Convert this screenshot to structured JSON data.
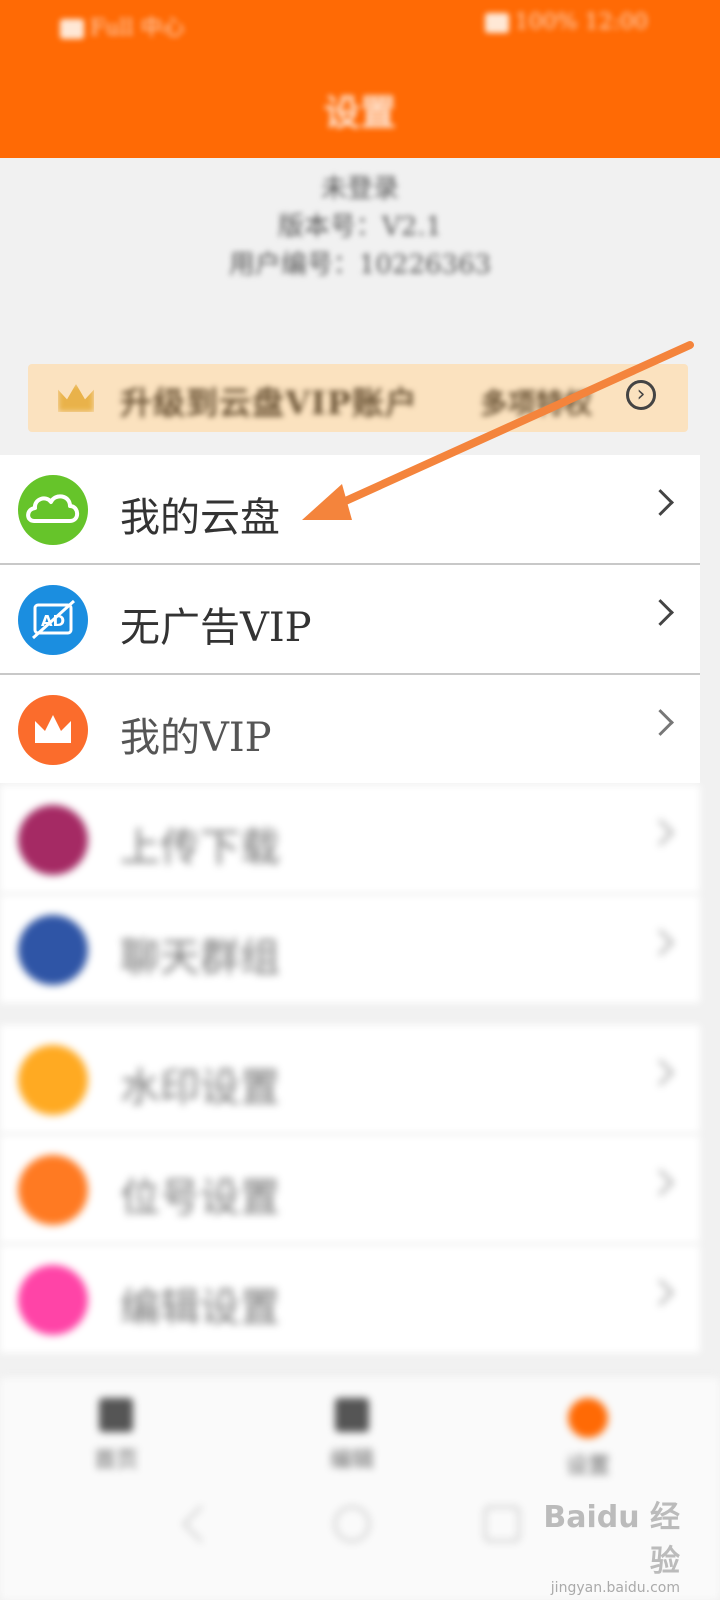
{
  "header": {
    "title": "设置",
    "status_left": "Full 中心",
    "status_right": "100% 12:00"
  },
  "account": {
    "line1": "未登录",
    "line2": "版本号：V2.1",
    "line3": "用户编号：10226363"
  },
  "vip_banner": {
    "text": "升级到云盘VIP账户",
    "sub": "多项特权",
    "arrow": "›"
  },
  "menu": {
    "cloud": "我的云盘",
    "adfree": "无广告VIP",
    "myvip": "我的VIP",
    "upload": "上传下载",
    "shared": "聊天群组",
    "watermark": "水印设置",
    "number": "位号设置",
    "edit": "编辑设置"
  },
  "icons": {
    "cloud": "cloud-icon",
    "adfree": "ad-block-icon",
    "myvip": "crown-icon",
    "adfree_text": "AD"
  },
  "bottom_nav": {
    "home": "首页",
    "tools": "编辑",
    "settings": "设置"
  },
  "watermark": {
    "logo": "Baidu 经验",
    "sub": "jingyan.baidu.com"
  },
  "colors": {
    "accent": "#ff6a05",
    "annotation": "#f4843c"
  }
}
